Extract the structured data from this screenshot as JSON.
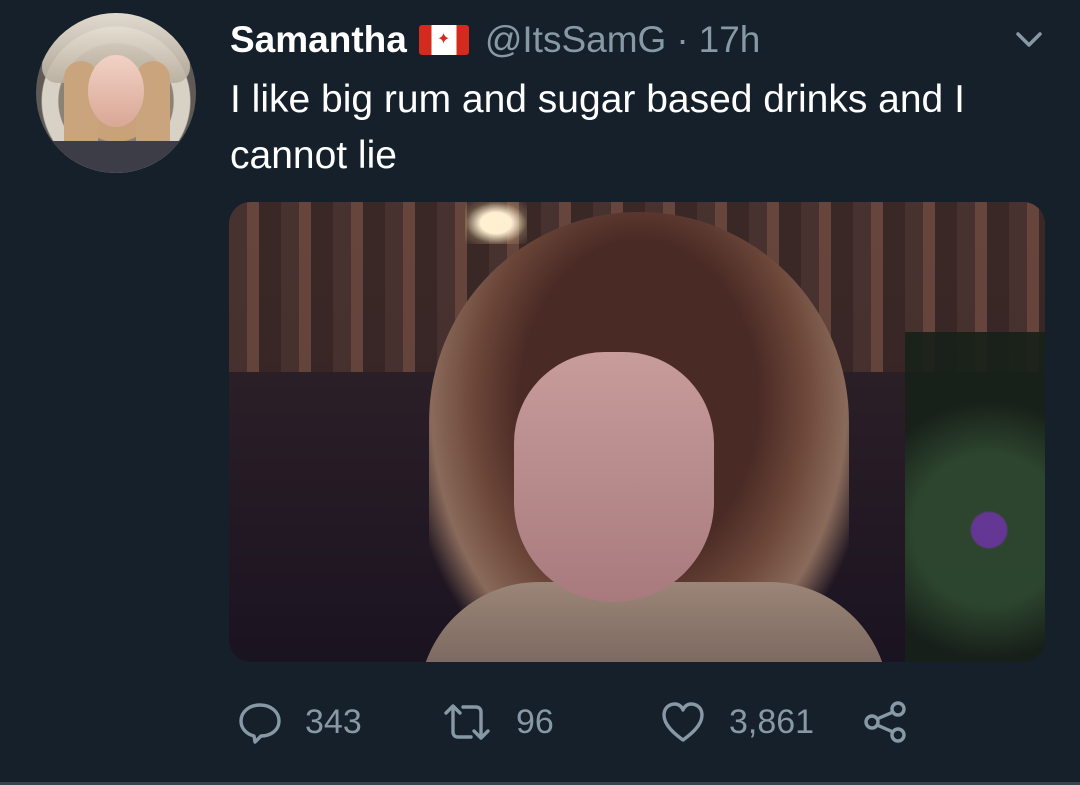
{
  "tweet": {
    "author_name": "Samantha",
    "flag_emoji": "🇨🇦",
    "handle": "@ItsSamG",
    "separator": "·",
    "time": "17h",
    "text": "I like big rum and sugar based drinks and I cannot lie"
  },
  "actions": {
    "replies": "343",
    "retweets": "96",
    "likes": "3,861"
  },
  "icons": {
    "menu": "chevron-down-icon",
    "reply": "reply-icon",
    "retweet": "retweet-icon",
    "like": "heart-icon",
    "share": "share-icon",
    "flag": "canada-flag-icon"
  },
  "colors": {
    "background": "#15202b",
    "text": "#ffffff",
    "secondary": "#8899a6",
    "divider": "#38444d",
    "flag_red": "#d52b1e"
  }
}
